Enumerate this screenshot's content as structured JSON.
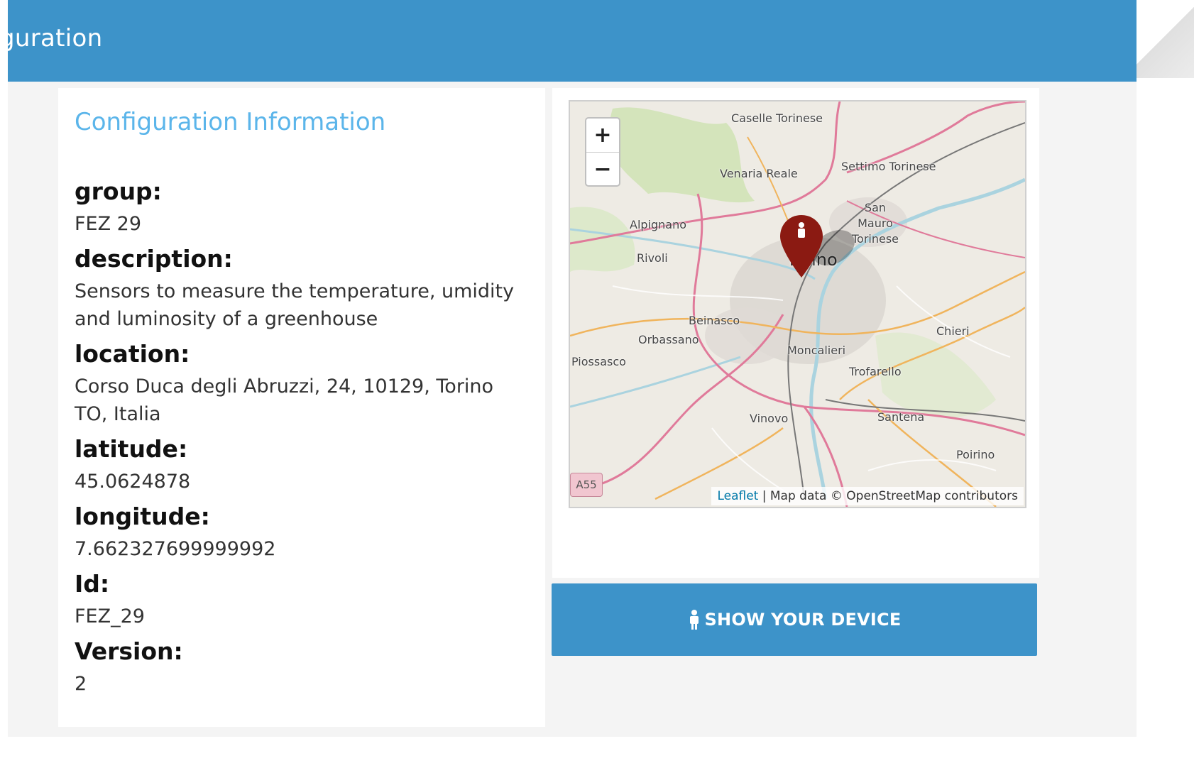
{
  "header": {
    "title": "guration"
  },
  "info": {
    "heading": "Configuration Information",
    "fields": [
      {
        "label": "group:",
        "value": "FEZ 29"
      },
      {
        "label": "description:",
        "value": "Sensors to measure the temperature, umidity and luminosity of a greenhouse"
      },
      {
        "label": "location:",
        "value": "Corso Duca degli Abruzzi, 24, 10129, Torino TO, Italia"
      },
      {
        "label": "latitude:",
        "value": "45.0624878"
      },
      {
        "label": "longitude:",
        "value": "7.662327699999992"
      },
      {
        "label": "Id:",
        "value": "FEZ_29"
      },
      {
        "label": "Version:",
        "value": "2"
      }
    ]
  },
  "map": {
    "zoom_in": "+",
    "zoom_out": "−",
    "places": [
      "Caselle Torinese",
      "Venaria Reale",
      "Settimo Torinese",
      "San Mauro Torinese",
      "Alpignano",
      "Rivoli",
      "Torino",
      "Beinasco",
      "Orbassano",
      "Moncalieri",
      "Chieri",
      "Piossasco",
      "Trofarello",
      "Vinovo",
      "Santena",
      "Poirino"
    ],
    "road_badge": "A55",
    "attribution_link": "Leaflet",
    "attribution_text": " | Map data © OpenStreetMap contributors",
    "marker_icon": "map-marker-icon"
  },
  "actions": {
    "show_device": "SHOW YOUR DEVICE",
    "show_device_icon": "person-icon"
  },
  "colors": {
    "header": "#3d93c9",
    "heading": "#5bb5ea",
    "button": "#3d93c9",
    "marker": "#8b1a12"
  }
}
